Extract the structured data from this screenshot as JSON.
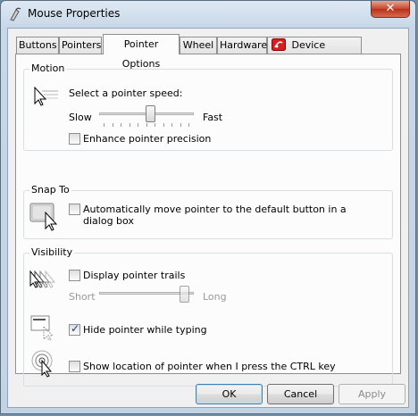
{
  "window": {
    "title": "Mouse Properties"
  },
  "tabs": [
    {
      "label": "Buttons"
    },
    {
      "label": "Pointers"
    },
    {
      "label": "Pointer Options"
    },
    {
      "label": "Wheel"
    },
    {
      "label": "Hardware"
    },
    {
      "label": "Device Settings"
    }
  ],
  "motion": {
    "title": "Motion",
    "speed_label": "Select a pointer speed:",
    "slow_label": "Slow",
    "fast_label": "Fast",
    "speed_level": 0.55,
    "precision_label": "Enhance pointer precision",
    "precision_checked": false
  },
  "snap": {
    "title": "Snap To",
    "label": "Automatically move pointer to the default button in a dialog box",
    "label_line1": "Automatically move pointer to the default button in a",
    "label_line2": "dialog box",
    "checked": false
  },
  "visibility": {
    "title": "Visibility",
    "trails_label": "Display pointer trails",
    "trails_checked": false,
    "short_label": "Short",
    "long_label": "Long",
    "trail_level": 0.95,
    "hide_label": "Hide pointer while typing",
    "hide_checked": true,
    "ctrl_label": "Show location of pointer when I press the CTRL key",
    "ctrl_checked": false
  },
  "buttons": {
    "ok": "OK",
    "cancel": "Cancel",
    "apply": "Apply"
  },
  "icons": [
    "mouse-app-icon",
    "close-icon",
    "device-settings-icon",
    "pointer-speed-icon",
    "snap-to-icon",
    "pointer-trails-icon",
    "hide-pointer-icon",
    "ctrl-location-icon"
  ]
}
